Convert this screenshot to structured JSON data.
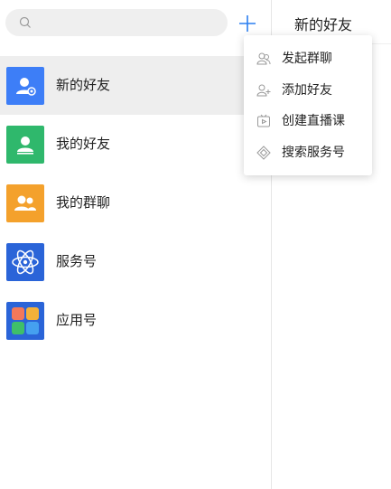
{
  "search": {
    "placeholder": ""
  },
  "list": {
    "items": [
      {
        "label": "新的好友",
        "icon": "new-friend-icon",
        "color": "#3d7ef7",
        "active": true
      },
      {
        "label": "我的好友",
        "icon": "my-friends-icon",
        "color": "#2fb86c",
        "active": false
      },
      {
        "label": "我的群聊",
        "icon": "group-chat-icon",
        "color": "#f4a12c",
        "active": false
      },
      {
        "label": "服务号",
        "icon": "service-account-icon",
        "color": "#2a64d8",
        "active": false
      },
      {
        "label": "应用号",
        "icon": "app-account-icon",
        "color": "#2a64d8",
        "active": false
      }
    ]
  },
  "right_panel": {
    "title": "新的好友"
  },
  "menu": {
    "items": [
      {
        "label": "发起群聊",
        "icon": "group-users-icon"
      },
      {
        "label": "添加好友",
        "icon": "add-user-icon"
      },
      {
        "label": "创建直播课",
        "icon": "live-class-icon"
      },
      {
        "label": "搜索服务号",
        "icon": "service-search-icon"
      }
    ]
  },
  "colors": {
    "accent": "#2a7ff0",
    "active_row": "#eeeeee",
    "search_bg": "#efefef"
  }
}
